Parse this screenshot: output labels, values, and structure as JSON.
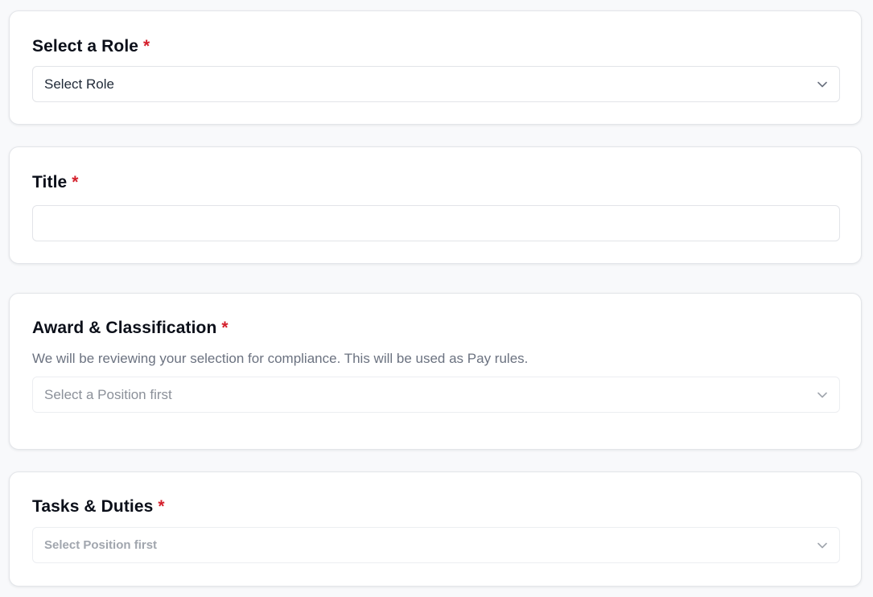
{
  "role_section": {
    "title": "Select a Role",
    "required_mark": "*",
    "select_value": "Select Role",
    "icon": "chevron-down-icon"
  },
  "title_section": {
    "title": "Title",
    "required_mark": "*",
    "input_value": "",
    "input_placeholder": ""
  },
  "award_section": {
    "title": "Award & Classification",
    "required_mark": "*",
    "description": "We will be reviewing your selection for compliance. This will be used as Pay rules.",
    "select_value": "Select a Position first",
    "icon": "chevron-down-icon"
  },
  "tasks_section": {
    "title": "Tasks & Duties",
    "required_mark": "*",
    "select_value": "Select Position first",
    "icon": "chevron-down-icon"
  },
  "colors": {
    "required": "#d41f2b",
    "background": "#f8f9fb",
    "card": "#ffffff",
    "border": "#e3e5e9",
    "muted_text": "#6b7280"
  }
}
